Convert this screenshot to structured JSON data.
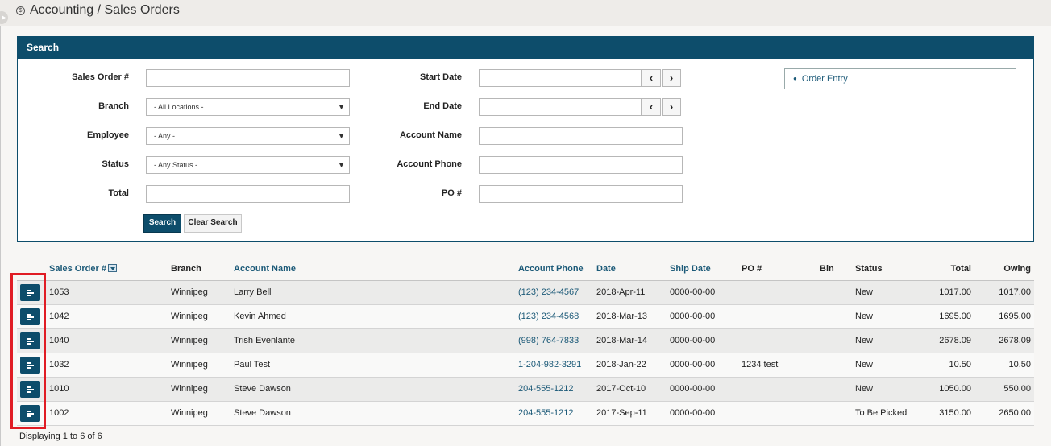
{
  "header": {
    "title": "Accounting / Sales Orders",
    "icon": "dollar-circle-icon"
  },
  "search": {
    "panel_title": "Search",
    "fields": {
      "sales_order": {
        "label": "Sales Order #",
        "value": ""
      },
      "branch": {
        "label": "Branch",
        "value": "- All Locations -"
      },
      "employee": {
        "label": "Employee",
        "value": "- Any -"
      },
      "status": {
        "label": "Status",
        "value": "- Any Status -"
      },
      "total": {
        "label": "Total",
        "value": ""
      },
      "start_date": {
        "label": "Start Date",
        "value": ""
      },
      "end_date": {
        "label": "End Date",
        "value": ""
      },
      "account_name": {
        "label": "Account Name",
        "value": ""
      },
      "account_phone": {
        "label": "Account Phone",
        "value": ""
      },
      "po": {
        "label": "PO #",
        "value": ""
      }
    },
    "prev_glyph": "‹",
    "next_glyph": "›",
    "search_button": "Search",
    "clear_button": "Clear Search",
    "quick_links": [
      "Order Entry"
    ]
  },
  "table": {
    "columns": {
      "sales_order": "Sales Order #",
      "branch": "Branch",
      "account_name": "Account Name",
      "account_phone": "Account Phone",
      "date": "Date",
      "ship_date": "Ship Date",
      "po": "PO #",
      "bin": "Bin",
      "status": "Status",
      "total": "Total",
      "owing": "Owing"
    },
    "rows": [
      {
        "sales_order": "1053",
        "branch": "Winnipeg",
        "account_name": "Larry Bell",
        "account_phone": "(123) 234-4567",
        "date": "2018-Apr-11",
        "ship_date": "0000-00-00",
        "po": "",
        "bin": "",
        "status": "New",
        "total": "1017.00",
        "owing": "1017.00"
      },
      {
        "sales_order": "1042",
        "branch": "Winnipeg",
        "account_name": "Kevin Ahmed",
        "account_phone": "(123) 234-4568",
        "date": "2018-Mar-13",
        "ship_date": "0000-00-00",
        "po": "",
        "bin": "",
        "status": "New",
        "total": "1695.00",
        "owing": "1695.00"
      },
      {
        "sales_order": "1040",
        "branch": "Winnipeg",
        "account_name": "Trish Evenlante",
        "account_phone": "(998) 764-7833",
        "date": "2018-Mar-14",
        "ship_date": "0000-00-00",
        "po": "",
        "bin": "",
        "status": "New",
        "total": "2678.09",
        "owing": "2678.09"
      },
      {
        "sales_order": "1032",
        "branch": "Winnipeg",
        "account_name": "Paul Test",
        "account_phone": "1-204-982-3291",
        "date": "2018-Jan-22",
        "ship_date": "0000-00-00",
        "po": "1234 test",
        "bin": "",
        "status": "New",
        "total": "10.50",
        "owing": "10.50"
      },
      {
        "sales_order": "1010",
        "branch": "Winnipeg",
        "account_name": "Steve Dawson",
        "account_phone": "204-555-1212",
        "date": "2017-Oct-10",
        "ship_date": "0000-00-00",
        "po": "",
        "bin": "",
        "status": "New",
        "total": "1050.00",
        "owing": "550.00"
      },
      {
        "sales_order": "1002",
        "branch": "Winnipeg",
        "account_name": "Steve Dawson",
        "account_phone": "204-555-1212",
        "date": "2017-Sep-11",
        "ship_date": "0000-00-00",
        "po": "",
        "bin": "",
        "status": "To Be Picked",
        "total": "3150.00",
        "owing": "2650.00"
      }
    ],
    "footer": "Displaying 1 to 6 of 6"
  },
  "colors": {
    "primary": "#0d4d6b",
    "link": "#1c5a78",
    "highlight": "#e01c24"
  }
}
